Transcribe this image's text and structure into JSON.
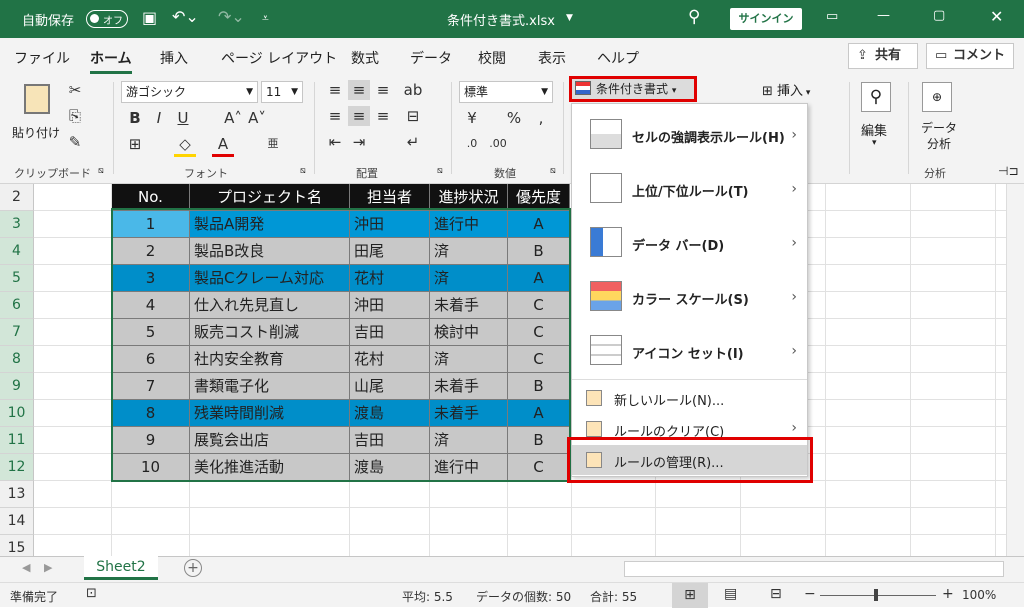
{
  "title_bar": {
    "autosave_label": "自動保存",
    "toggle_state": "オフ",
    "file_name": "条件付き書式.xlsx",
    "sign_in": "サインイン"
  },
  "tabs": [
    "ファイル",
    "ホーム",
    "挿入",
    "ページ レイアウト",
    "数式",
    "データ",
    "校閲",
    "表示",
    "ヘルプ"
  ],
  "active_tab": "ホーム",
  "share_label": "共有",
  "comment_label": "コメント",
  "ribbon": {
    "paste_label": "貼り付け",
    "clipboard_group": "クリップボード",
    "font_name": "游ゴシック",
    "font_size": "11",
    "font_group": "フォント",
    "align_group": "配置",
    "number_format": "標準",
    "number_group": "数値",
    "cond_format_label": "条件付き書式",
    "insert_label": "挿入",
    "edit_label": "編集",
    "analysis_label": "データ\n分析",
    "analysis_group": "分析"
  },
  "conditional_format_menu": {
    "items": [
      {
        "label": "セルの強調表示ルール(H)",
        "has_submenu": true
      },
      {
        "label": "上位/下位ルール(T)",
        "has_submenu": true
      },
      {
        "label": "データ バー(D)",
        "has_submenu": true
      },
      {
        "label": "カラー スケール(S)",
        "has_submenu": true
      },
      {
        "label": "アイコン セット(I)",
        "has_submenu": true
      }
    ],
    "small_items": [
      {
        "label": "新しいルール(N)...",
        "has_submenu": false
      },
      {
        "label": "ルールのクリア(C)",
        "has_submenu": true
      },
      {
        "label": "ルールの管理(R)...",
        "has_submenu": false
      }
    ]
  },
  "sheet": {
    "row_numbers": [
      "2",
      "3",
      "4",
      "5",
      "6",
      "7",
      "8",
      "9",
      "10",
      "11",
      "12",
      "13",
      "14",
      "15"
    ],
    "headers": [
      "No.",
      "プロジェクト名",
      "担当者",
      "進捗状況",
      "優先度"
    ],
    "rows": [
      {
        "no": "1",
        "name": "製品A開発",
        "owner": "沖田",
        "status": "進行中",
        "priority": "A",
        "highlight": "#0097d6",
        "selected": true
      },
      {
        "no": "2",
        "name": "製品B改良",
        "owner": "田尾",
        "status": "済",
        "priority": "B",
        "highlight": "#c8c8c8",
        "selected": false
      },
      {
        "no": "3",
        "name": "製品Cクレーム対応",
        "owner": "花村",
        "status": "済",
        "priority": "A",
        "highlight": "#008ec9",
        "selected": false
      },
      {
        "no": "4",
        "name": "仕入れ先見直し",
        "owner": "沖田",
        "status": "未着手",
        "priority": "C",
        "highlight": "#c8c8c8",
        "selected": false
      },
      {
        "no": "5",
        "name": "販売コスト削減",
        "owner": "吉田",
        "status": "検討中",
        "priority": "C",
        "highlight": "#c8c8c8",
        "selected": false
      },
      {
        "no": "6",
        "name": "社内安全教育",
        "owner": "花村",
        "status": "済",
        "priority": "C",
        "highlight": "#c8c8c8",
        "selected": false
      },
      {
        "no": "7",
        "name": "書類電子化",
        "owner": "山尾",
        "status": "未着手",
        "priority": "B",
        "highlight": "#c8c8c8",
        "selected": false
      },
      {
        "no": "8",
        "name": "残業時間削減",
        "owner": "渡島",
        "status": "未着手",
        "priority": "A",
        "highlight": "#008ec9",
        "selected": false
      },
      {
        "no": "9",
        "name": "展覧会出店",
        "owner": "吉田",
        "status": "済",
        "priority": "B",
        "highlight": "#c8c8c8",
        "selected": false
      },
      {
        "no": "10",
        "name": "美化推進活動",
        "owner": "渡島",
        "status": "進行中",
        "priority": "C",
        "highlight": "#c8c8c8",
        "selected": false
      }
    ]
  },
  "sheet_tab": "Sheet2",
  "status_bar": {
    "ready": "準備完了",
    "average": "平均: 5.5",
    "count": "データの個数: 50",
    "sum": "合計: 55",
    "zoom": "100%"
  },
  "colors": {
    "excel_green": "#217346",
    "header_black": "#111111",
    "red_highlight": "#e00000"
  }
}
